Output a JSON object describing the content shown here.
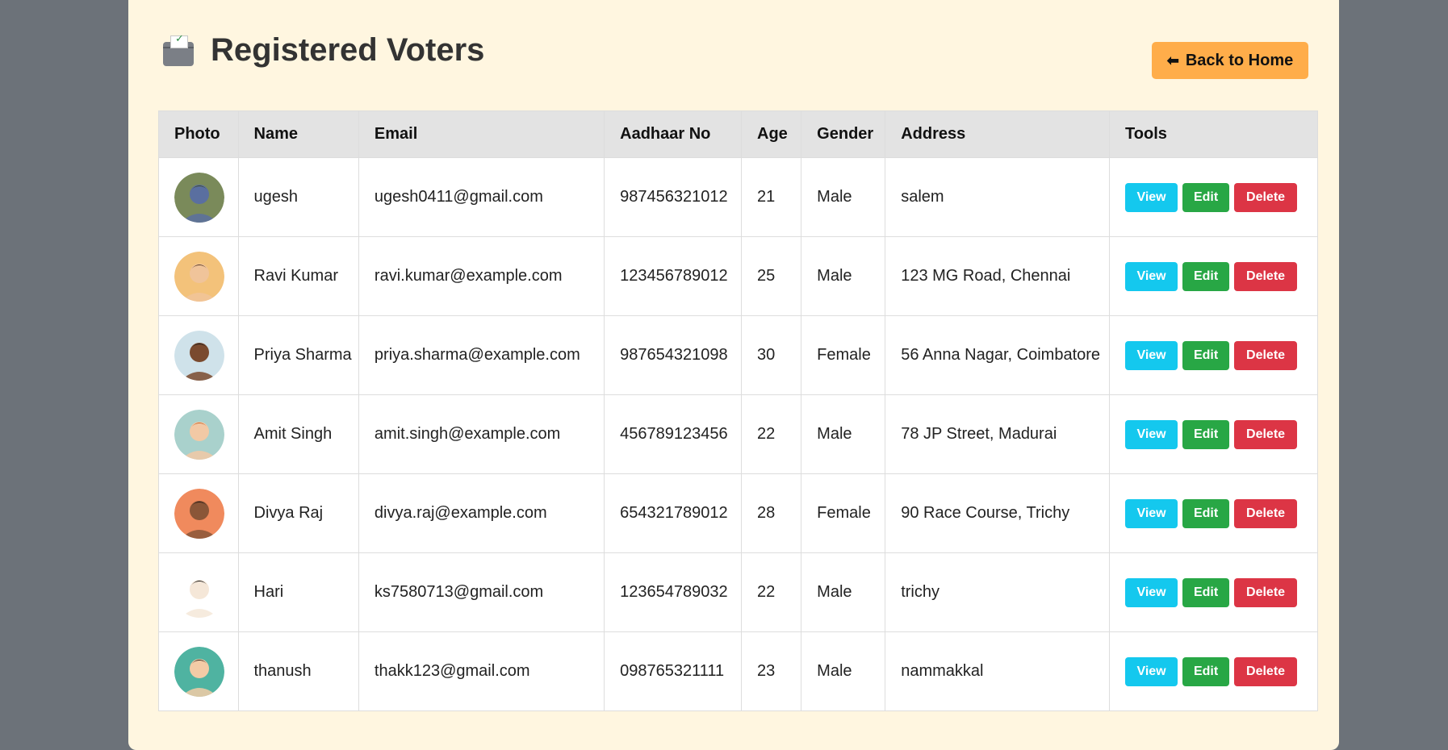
{
  "header": {
    "title": "Registered Voters",
    "icon": "ballot-box-icon",
    "back_button": "Back to Home"
  },
  "table": {
    "columns": [
      "Photo",
      "Name",
      "Email",
      "Aadhaar No",
      "Age",
      "Gender",
      "Address",
      "Tools"
    ],
    "rows": [
      {
        "name": "ugesh",
        "email": "ugesh0411@gmail.com",
        "aadhaar": "987456321012",
        "age": "21",
        "gender": "Male",
        "address": "salem"
      },
      {
        "name": "Ravi Kumar",
        "email": "ravi.kumar@example.com",
        "aadhaar": "123456789012",
        "age": "25",
        "gender": "Male",
        "address": "123 MG Road, Chennai"
      },
      {
        "name": "Priya Sharma",
        "email": "priya.sharma@example.com",
        "aadhaar": "987654321098",
        "age": "30",
        "gender": "Female",
        "address": "56 Anna Nagar, Coimbatore"
      },
      {
        "name": "Amit Singh",
        "email": "amit.singh@example.com",
        "aadhaar": "456789123456",
        "age": "22",
        "gender": "Male",
        "address": "78 JP Street, Madurai"
      },
      {
        "name": "Divya Raj",
        "email": "divya.raj@example.com",
        "aadhaar": "654321789012",
        "age": "28",
        "gender": "Female",
        "address": "90 Race Course, Trichy"
      },
      {
        "name": "Hari",
        "email": "ks7580713@gmail.com",
        "aadhaar": "123654789032",
        "age": "22",
        "gender": "Male",
        "address": "trichy"
      },
      {
        "name": "thanush",
        "email": "thakk123@gmail.com",
        "aadhaar": "098765321111",
        "age": "23",
        "gender": "Male",
        "address": "nammakkal"
      }
    ]
  },
  "tools": {
    "view": "View",
    "edit": "Edit",
    "delete": "Delete"
  },
  "avatars": [
    {
      "bg": "#7a8a5a",
      "skin": "#5a6fa0",
      "hair": "#3d4a2a"
    },
    {
      "bg": "#f3c27a",
      "skin": "#f0c49a",
      "hair": "#5a3a22"
    },
    {
      "bg": "#cfe2ea",
      "skin": "#7a4a2e",
      "hair": "#1d1d1d"
    },
    {
      "bg": "#a9d1cc",
      "skin": "#f2c9a5",
      "hair": "#c7662d"
    },
    {
      "bg": "#f08a5d",
      "skin": "#8a5638",
      "hair": "#2a1a14"
    },
    {
      "bg": "#ffffff",
      "skin": "#f5e7d8",
      "hair": "#111111"
    },
    {
      "bg": "#4fb3a1",
      "skin": "#f3cba6",
      "hair": "#2a1f1a"
    }
  ]
}
